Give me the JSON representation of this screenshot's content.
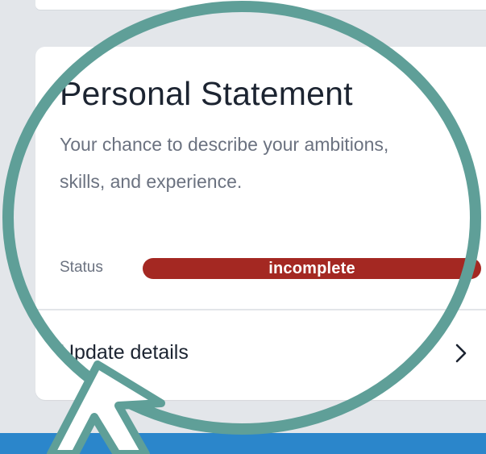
{
  "card": {
    "title": "Personal Statement",
    "description": "Your chance to describe your ambitions, skills, and experience.",
    "status_label": "Status",
    "status_value": "incomplete",
    "action_label": "Update details"
  },
  "icons": {
    "action": "chevron-right-icon",
    "pointer": "arrow-cursor-icon"
  },
  "colors": {
    "background": "#e3e6ea",
    "card": "#ffffff",
    "title": "#1c2431",
    "muted": "#6b7280",
    "status_incomplete": "#a42822",
    "magnifier_ring": "#5f9f98",
    "bottom_bar": "#2b86cb"
  }
}
